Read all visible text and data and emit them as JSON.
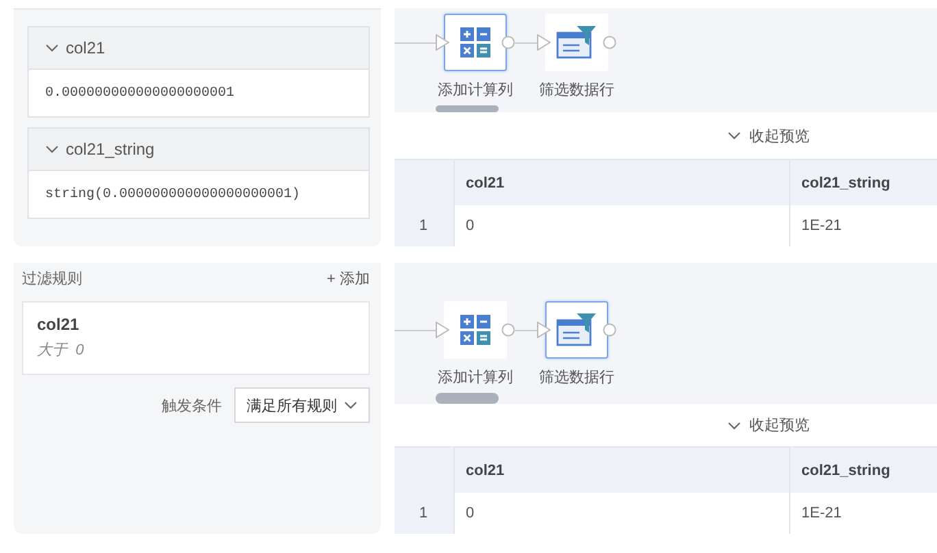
{
  "panels": [
    {
      "left": {
        "kind": "fields",
        "fields": [
          {
            "name": "col21",
            "expanded": true,
            "value": "0.000000000000000000001"
          },
          {
            "name": "col21_string",
            "expanded": true,
            "value": "string(0.000000000000000000001)"
          }
        ]
      },
      "flow": {
        "nodes": [
          {
            "label": "添加计算列",
            "kind": "calc",
            "selected": true
          },
          {
            "label": "筛选数据行",
            "kind": "filter",
            "selected": false
          }
        ]
      },
      "preview_toggle": "收起预览",
      "table": {
        "columns": [
          "col21",
          "col21_string"
        ],
        "rows": [
          {
            "index": "1",
            "cells": [
              "0",
              "1E-21"
            ]
          }
        ]
      }
    },
    {
      "left": {
        "kind": "rules",
        "title": "过滤规则",
        "add_button": "+ 添加",
        "rules": [
          {
            "field": "col21",
            "condition": "大于  0"
          }
        ],
        "trigger_label": "触发条件",
        "trigger_value": "满足所有规则"
      },
      "flow": {
        "nodes": [
          {
            "label": "添加计算列",
            "kind": "calc",
            "selected": false
          },
          {
            "label": "筛选数据行",
            "kind": "filter",
            "selected": true
          }
        ]
      },
      "preview_toggle": "收起预览",
      "table": {
        "columns": [
          "col21",
          "col21_string"
        ],
        "rows": [
          {
            "index": "1",
            "cells": [
              "0",
              "1E-21"
            ]
          }
        ]
      }
    }
  ]
}
